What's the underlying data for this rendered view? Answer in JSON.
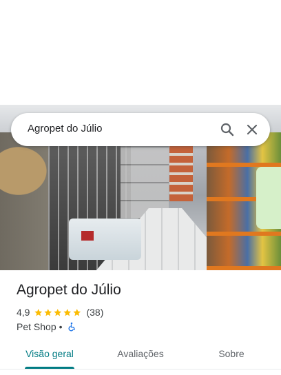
{
  "search": {
    "query": "Agropet do Júlio",
    "search_icon": "search-icon",
    "close_icon": "close-icon"
  },
  "place": {
    "name": "Agropet do Júlio",
    "rating": "4,9",
    "rating_stars": 5,
    "review_count": "(38)",
    "category": "Pet Shop",
    "separator": "•",
    "accessibility_icon": "wheelchair-icon"
  },
  "tabs": [
    {
      "label": "Visão geral",
      "active": true
    },
    {
      "label": "Avaliações",
      "active": false
    },
    {
      "label": "Sobre",
      "active": false
    }
  ],
  "colors": {
    "accent": "#007b83",
    "star": "#fbbc04",
    "accessibility": "#1a73e8"
  }
}
